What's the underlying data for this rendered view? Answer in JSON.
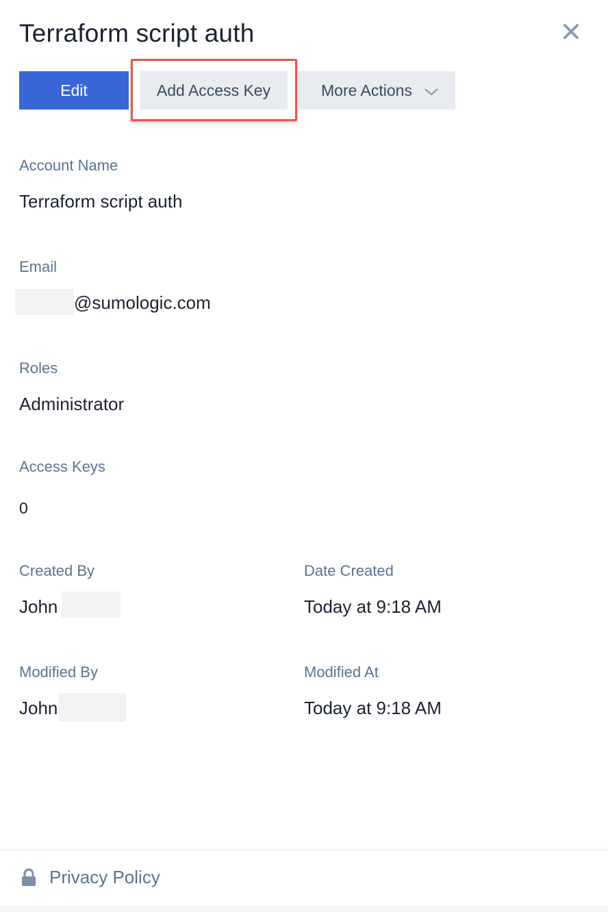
{
  "panel": {
    "title": "Terraform script auth",
    "close_icon": "close-icon"
  },
  "toolbar": {
    "edit_label": "Edit",
    "add_access_key_label": "Add Access Key",
    "more_actions_label": "More Actions",
    "more_actions_icon": "chevron-down-icon"
  },
  "fields": {
    "account_name": {
      "label": "Account Name",
      "value": "Terraform script auth"
    },
    "email": {
      "label": "Email",
      "value": "@sumologic.com"
    },
    "roles": {
      "label": "Roles",
      "value": "Administrator"
    },
    "access_keys": {
      "label": "Access Keys",
      "value": "0"
    },
    "created_by": {
      "label": "Created By",
      "value": "John"
    },
    "date_created": {
      "label": "Date Created",
      "value": "Today at 9:18 AM"
    },
    "modified_by": {
      "label": "Modified By",
      "value": "John"
    },
    "modified_at": {
      "label": "Modified At",
      "value": "Today at 9:18 AM"
    }
  },
  "footer": {
    "privacy_label": "Privacy Policy",
    "privacy_icon": "lock-icon"
  },
  "colors": {
    "primary": "#3a66d8",
    "secondary_button": "#e8ecf0",
    "label": "#5b7390",
    "highlight": "#e2584a"
  }
}
